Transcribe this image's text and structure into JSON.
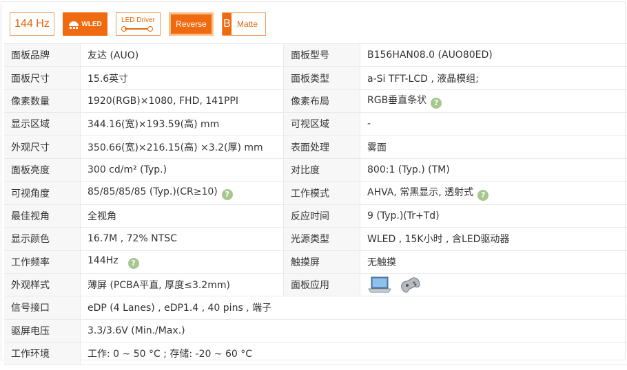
{
  "badges": {
    "refresh": "144 Hz",
    "wled": "WLED",
    "led_driver": "LED Driver",
    "reverse": "Reverse",
    "matte_letter": "B",
    "matte": "Matte"
  },
  "colors": {
    "accent": "#f06a0f",
    "link": "#3b5a9a",
    "help": "#a6c88f",
    "label_bg": "#f7f7f7"
  },
  "rows": [
    {
      "l1": "面板品牌",
      "v1": "友达 (AUO)",
      "l2": "面板型号",
      "v2": "B156HAN08.0 (AUO80ED)"
    },
    {
      "l1": "面板尺寸",
      "v1": "15.6英寸",
      "l2": "面板类型",
      "v2": "a-Si TFT-LCD , 液晶模组;"
    },
    {
      "l1": "像素数量",
      "v1": "1920(RGB)×1080, FHD, 141PPI",
      "l2": "像素布局",
      "v2": "RGB垂直条状"
    },
    {
      "l1": "显示区域",
      "v1": "344.16(宽)×193.59(高) mm",
      "l2": "可视区域",
      "v2": "-"
    },
    {
      "l1": "外观尺寸",
      "v1": "350.66(宽)×216.15(高) ×3.2(厚) mm",
      "l2": "表面处理",
      "v2": "雾面"
    },
    {
      "l1": "面板亮度",
      "v1": "300 cd/m² (Typ.)",
      "l2": "对比度",
      "v2": "800:1 (Typ.) (TM)"
    },
    {
      "l1": "可视角度",
      "v1": "85/85/85/85 (Typ.)(CR≥10)",
      "l2": "工作模式",
      "v2": "AHVA, 常黑显示, 透射式"
    },
    {
      "l1": "最佳视角",
      "v1": "全视角",
      "l2": "反应时间",
      "v2": "9 (Typ.)(Tr+Td)"
    },
    {
      "l1": "显示颜色",
      "v1": "16.7M , 72% NTSC",
      "l2": "光源类型",
      "v2": "WLED , 15K小时 , 含LED驱动器"
    },
    {
      "l1": "工作频率",
      "v1": "144Hz",
      "l2": "触摸屏",
      "v2": "无触摸"
    },
    {
      "l1": "外观样式",
      "v1": "薄屏 (PCBA平直, 厚度≤3.2mm)",
      "l2": "面板应用",
      "v2": ""
    },
    {
      "l1": "信号接口",
      "v1": "eDP (4 Lanes) , eDP1.4 , 40 pins , 端子"
    },
    {
      "l1": "驱屏电压",
      "v1": "3.3/3.6V (Min./Max.)"
    },
    {
      "l1": "工作环境",
      "v1": "工作: 0 ~ 50 °C ; 存储: -20 ~ 60 °C"
    }
  ],
  "help_mark": "?",
  "app_icons": [
    "laptop-icon",
    "gamepad-icon"
  ]
}
